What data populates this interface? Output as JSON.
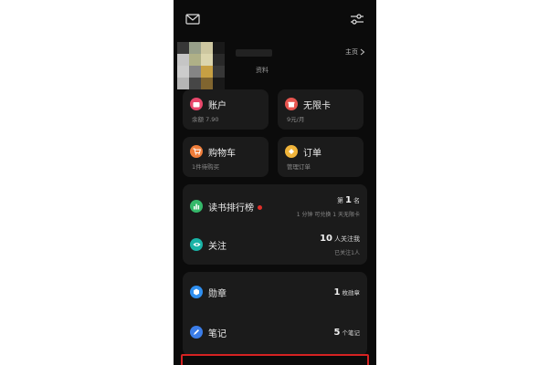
{
  "profile": {
    "caption": "资料",
    "homepage_link": "主页"
  },
  "cards": {
    "account": {
      "title": "账户",
      "sub": "余额 7.90",
      "color": "#e8476b"
    },
    "unlimited": {
      "title": "无限卡",
      "sub": "9元/月",
      "color": "#e7554f"
    },
    "cart": {
      "title": "购物车",
      "sub": "1件待购买",
      "color": "#ef7d3a"
    },
    "order": {
      "title": "订单",
      "sub": "管理订单",
      "color": "#f0b43a"
    }
  },
  "section1": {
    "ranking": {
      "title": "读书排行榜",
      "rank_prefix": "第",
      "rank_value": "1",
      "rank_suffix": "名",
      "sub": "1 分钟 可兑换 1 天无限卡",
      "color": "#35b86a"
    },
    "follow": {
      "title": "关注",
      "count": "10",
      "count_suffix": "人关注我",
      "sub": "已关注1人",
      "color": "#19b3a6"
    }
  },
  "section2": {
    "badges": {
      "title": "勋章",
      "count": "1",
      "suffix": "枚勋章",
      "color": "#2f8ff0"
    },
    "notes": {
      "title": "笔记",
      "count": "5",
      "suffix": "个笔记",
      "color": "#3b7de8"
    }
  }
}
